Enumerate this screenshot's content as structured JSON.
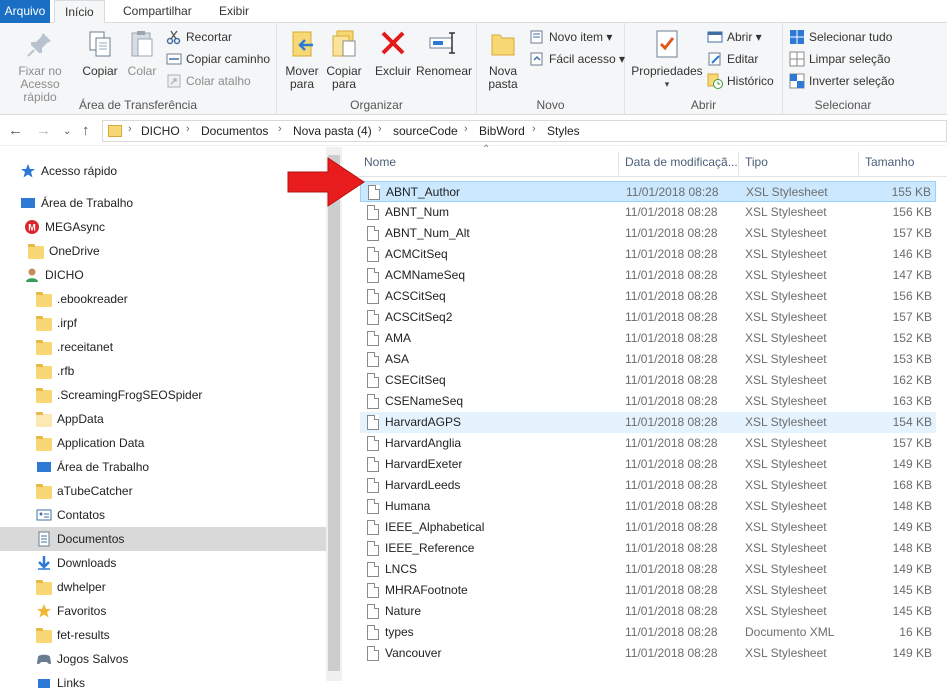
{
  "menu": {
    "file": "Arquivo",
    "home": "Início",
    "share": "Compartilhar",
    "view": "Exibir"
  },
  "ribbon": {
    "clipboard": {
      "label": "Área de Transferência",
      "pin": "Fixar no Acesso rápido",
      "copy": "Copiar",
      "paste": "Colar",
      "cut": "Recortar",
      "copy_path": "Copiar caminho",
      "paste_shortcut": "Colar atalho"
    },
    "organize": {
      "label": "Organizar",
      "move_to": "Mover para",
      "copy_to": "Copiar para",
      "delete": "Excluir",
      "rename": "Renomear"
    },
    "new": {
      "label": "Novo",
      "new_folder": "Nova pasta",
      "new_item": "Novo item",
      "easy_access": "Fácil acesso"
    },
    "open": {
      "label": "Abrir",
      "properties": "Propriedades",
      "open": "Abrir",
      "edit": "Editar",
      "history": "Histórico"
    },
    "select": {
      "label": "Selecionar",
      "select_all": "Selecionar tudo",
      "select_none": "Limpar seleção",
      "invert": "Inverter seleção"
    }
  },
  "breadcrumb": [
    "DICHO",
    "Documentos",
    "Nova pasta (4)",
    "sourceCode",
    "BibWord",
    "Styles"
  ],
  "sidebar": {
    "items": [
      {
        "label": "Acesso rápido",
        "icon": "star-icon"
      },
      {
        "label": "Área de Trabalho",
        "icon": "desktop-icon"
      },
      {
        "label": "MEGAsync",
        "icon": "mega-icon"
      },
      {
        "label": "OneDrive",
        "icon": "folder-icon"
      },
      {
        "label": "DICHO",
        "icon": "user-icon"
      },
      {
        "label": ".ebookreader",
        "icon": "folder-icon"
      },
      {
        "label": ".irpf",
        "icon": "folder-icon"
      },
      {
        "label": ".receitanet",
        "icon": "folder-icon"
      },
      {
        "label": ".rfb",
        "icon": "folder-icon"
      },
      {
        "label": ".ScreamingFrogSEOSpider",
        "icon": "folder-icon"
      },
      {
        "label": "AppData",
        "icon": "folder-icon"
      },
      {
        "label": "Application Data",
        "icon": "folder-icon"
      },
      {
        "label": "Área de Trabalho",
        "icon": "desktop-icon"
      },
      {
        "label": "aTubeCatcher",
        "icon": "folder-icon"
      },
      {
        "label": "Contatos",
        "icon": "contacts-icon"
      },
      {
        "label": "Documentos",
        "icon": "documents-icon"
      },
      {
        "label": "Downloads",
        "icon": "download-icon"
      },
      {
        "label": "dwhelper",
        "icon": "folder-icon"
      },
      {
        "label": "Favoritos",
        "icon": "star-icon"
      },
      {
        "label": "fet-results",
        "icon": "folder-icon"
      },
      {
        "label": "Jogos Salvos",
        "icon": "games-icon"
      },
      {
        "label": "Links",
        "icon": "links-icon"
      }
    ]
  },
  "columns": {
    "name": "Nome",
    "date": "Data de modificaçã...",
    "type": "Tipo",
    "size": "Tamanho"
  },
  "files": [
    {
      "name": "ABNT_Author",
      "date": "11/01/2018 08:28",
      "type": "XSL Stylesheet",
      "size": "155 KB"
    },
    {
      "name": "ABNT_Num",
      "date": "11/01/2018 08:28",
      "type": "XSL Stylesheet",
      "size": "156 KB"
    },
    {
      "name": "ABNT_Num_Alt",
      "date": "11/01/2018 08:28",
      "type": "XSL Stylesheet",
      "size": "157 KB"
    },
    {
      "name": "ACMCitSeq",
      "date": "11/01/2018 08:28",
      "type": "XSL Stylesheet",
      "size": "146 KB"
    },
    {
      "name": "ACMNameSeq",
      "date": "11/01/2018 08:28",
      "type": "XSL Stylesheet",
      "size": "147 KB"
    },
    {
      "name": "ACSCitSeq",
      "date": "11/01/2018 08:28",
      "type": "XSL Stylesheet",
      "size": "156 KB"
    },
    {
      "name": "ACSCitSeq2",
      "date": "11/01/2018 08:28",
      "type": "XSL Stylesheet",
      "size": "157 KB"
    },
    {
      "name": "AMA",
      "date": "11/01/2018 08:28",
      "type": "XSL Stylesheet",
      "size": "152 KB"
    },
    {
      "name": "ASA",
      "date": "11/01/2018 08:28",
      "type": "XSL Stylesheet",
      "size": "153 KB"
    },
    {
      "name": "CSECitSeq",
      "date": "11/01/2018 08:28",
      "type": "XSL Stylesheet",
      "size": "162 KB"
    },
    {
      "name": "CSENameSeq",
      "date": "11/01/2018 08:28",
      "type": "XSL Stylesheet",
      "size": "163 KB"
    },
    {
      "name": "HarvardAGPS",
      "date": "11/01/2018 08:28",
      "type": "XSL Stylesheet",
      "size": "154 KB"
    },
    {
      "name": "HarvardAnglia",
      "date": "11/01/2018 08:28",
      "type": "XSL Stylesheet",
      "size": "157 KB"
    },
    {
      "name": "HarvardExeter",
      "date": "11/01/2018 08:28",
      "type": "XSL Stylesheet",
      "size": "149 KB"
    },
    {
      "name": "HarvardLeeds",
      "date": "11/01/2018 08:28",
      "type": "XSL Stylesheet",
      "size": "168 KB"
    },
    {
      "name": "Humana",
      "date": "11/01/2018 08:28",
      "type": "XSL Stylesheet",
      "size": "148 KB"
    },
    {
      "name": "IEEE_Alphabetical",
      "date": "11/01/2018 08:28",
      "type": "XSL Stylesheet",
      "size": "149 KB"
    },
    {
      "name": "IEEE_Reference",
      "date": "11/01/2018 08:28",
      "type": "XSL Stylesheet",
      "size": "148 KB"
    },
    {
      "name": "LNCS",
      "date": "11/01/2018 08:28",
      "type": "XSL Stylesheet",
      "size": "149 KB"
    },
    {
      "name": "MHRAFootnote",
      "date": "11/01/2018 08:28",
      "type": "XSL Stylesheet",
      "size": "145 KB"
    },
    {
      "name": "Nature",
      "date": "11/01/2018 08:28",
      "type": "XSL Stylesheet",
      "size": "145 KB"
    },
    {
      "name": "types",
      "date": "11/01/2018 08:28",
      "type": "Documento XML",
      "size": "16 KB"
    },
    {
      "name": "Vancouver",
      "date": "11/01/2018 08:28",
      "type": "XSL Stylesheet",
      "size": "149 KB"
    }
  ],
  "colors": {
    "accent": "#1a6fc4",
    "selected_row": "#cce8ff",
    "arrow": "#e81c1c"
  }
}
